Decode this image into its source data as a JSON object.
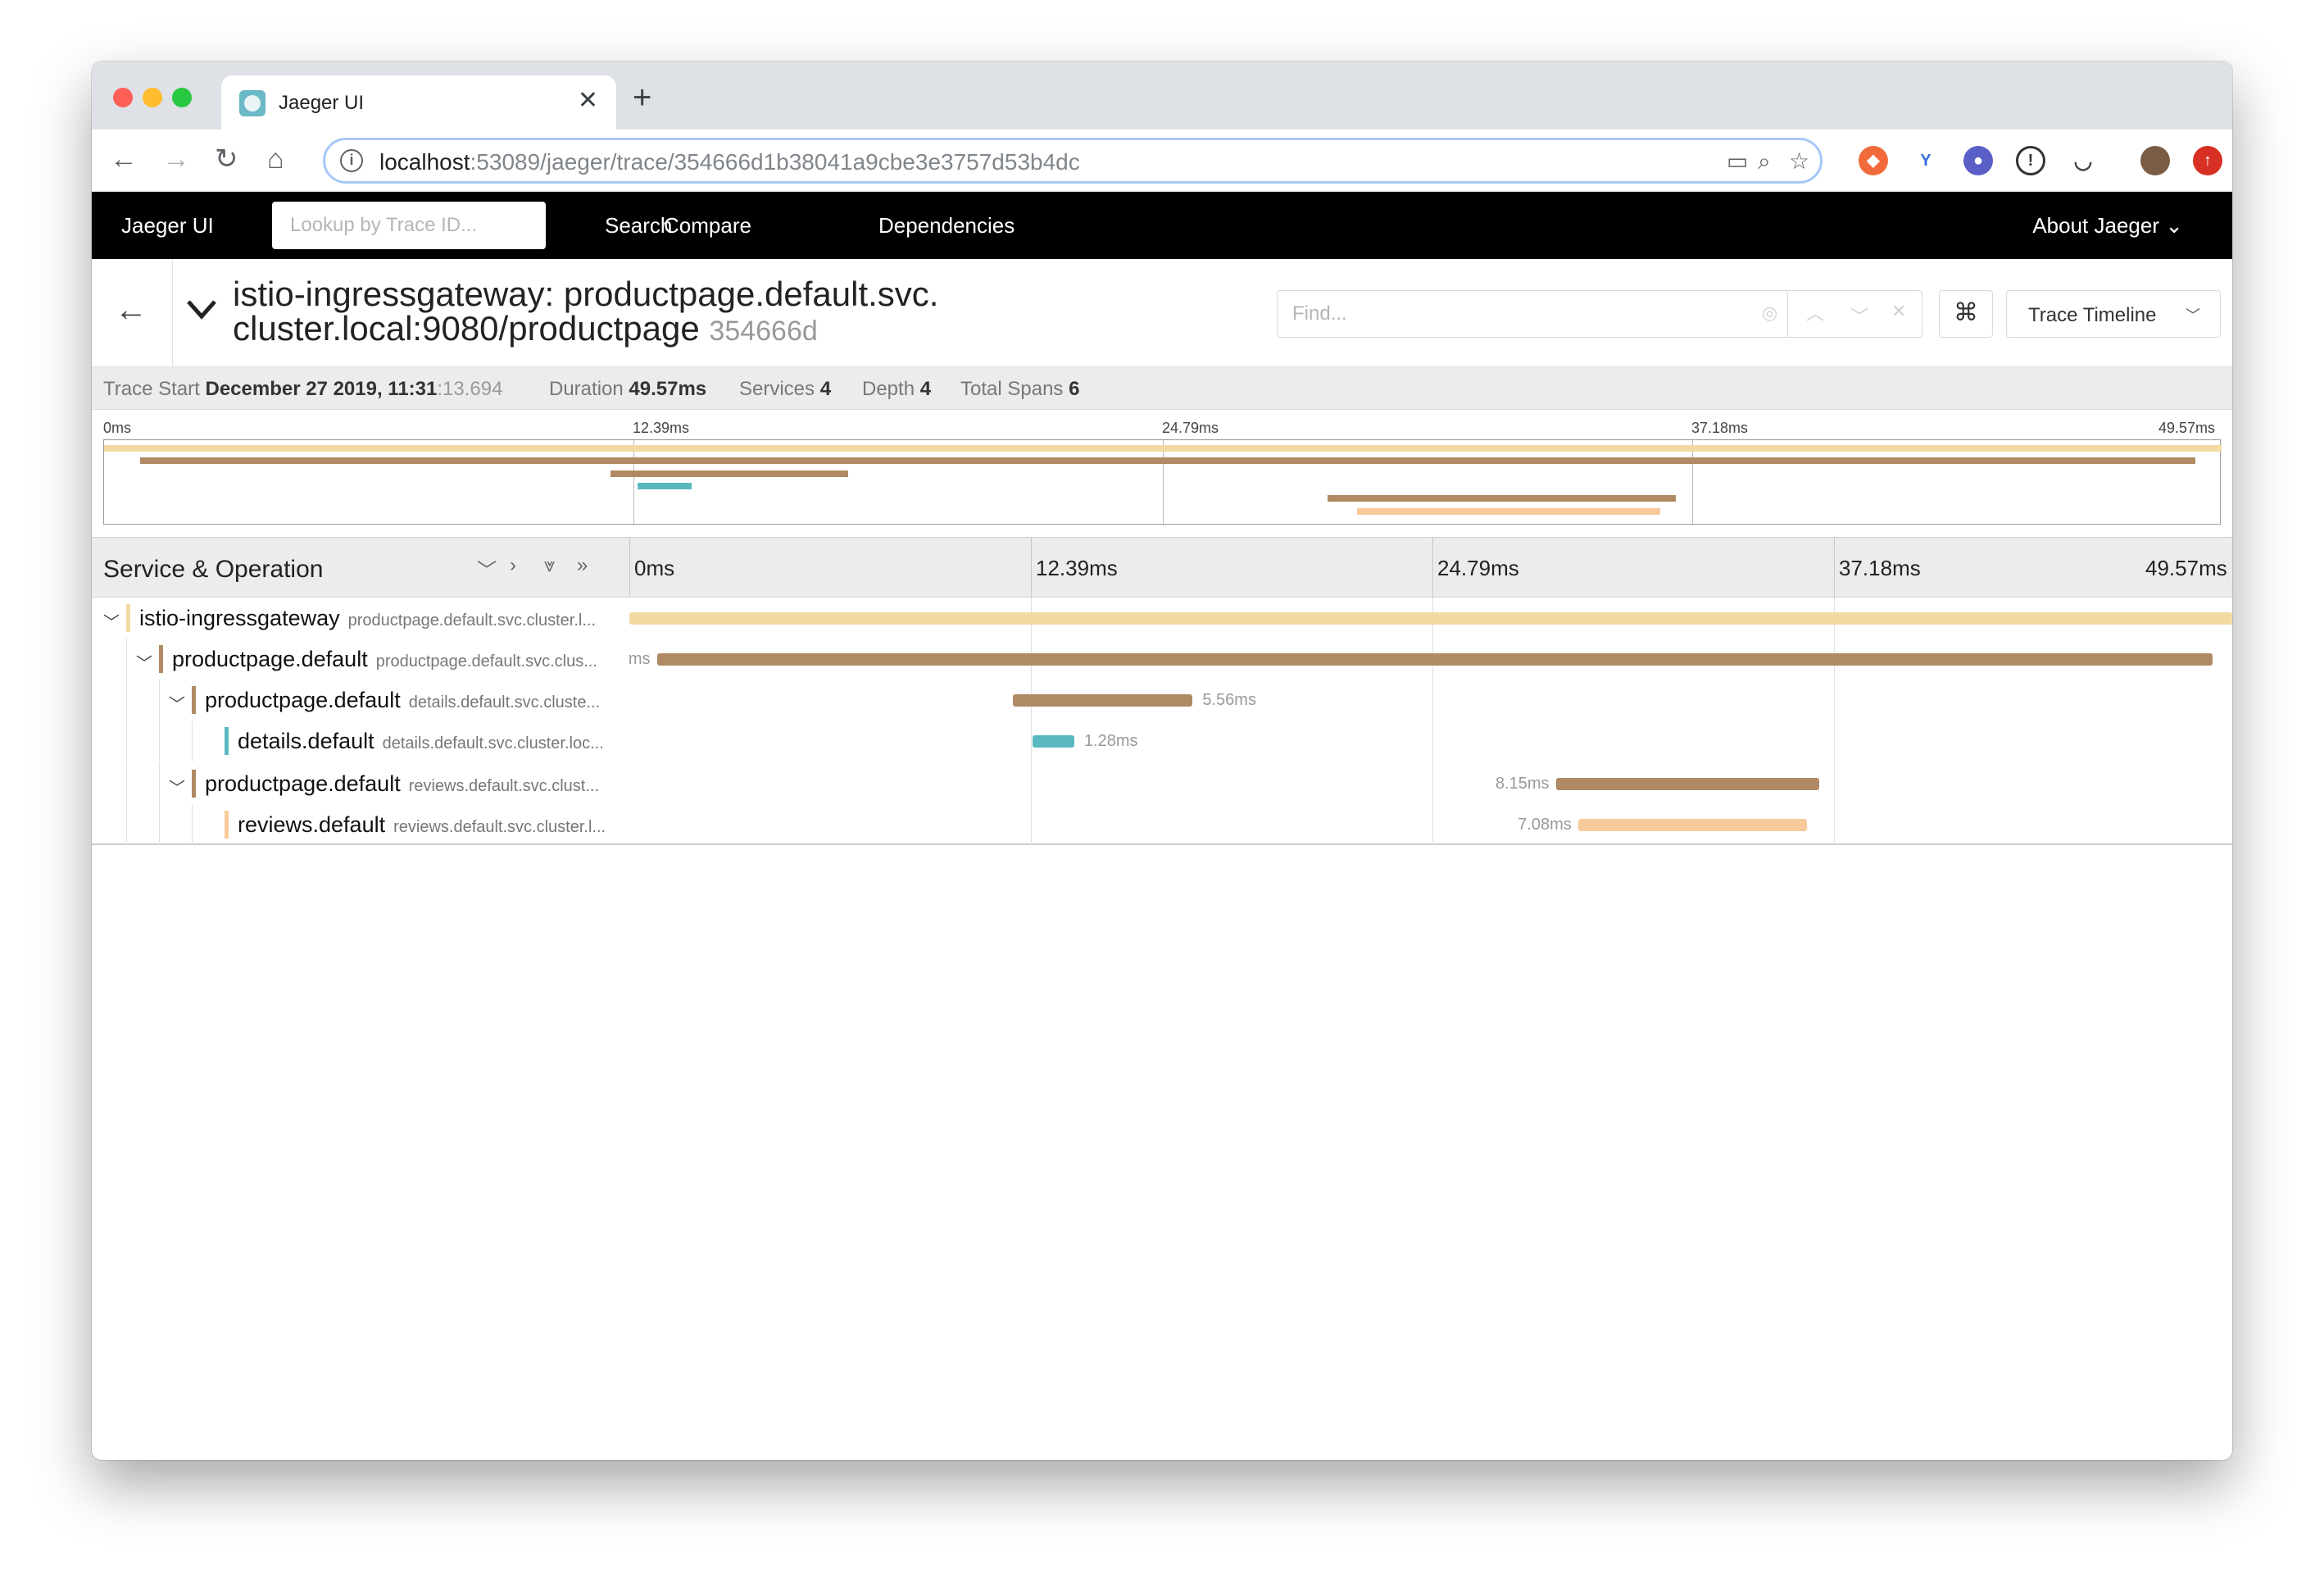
{
  "browser": {
    "tab_title": "Jaeger UI",
    "tab_close": "✕",
    "new_tab": "+",
    "url_host": "localhost",
    "url_rest": ":53089/jaeger/trace/354666d1b38041a9cbe3e3757d53b4dc"
  },
  "nav": {
    "brand": "Jaeger UI",
    "lookup_placeholder": "Lookup by Trace ID...",
    "search": "Search",
    "compare": "Compare",
    "dependencies": "Dependencies",
    "about": "About Jaeger ⌄"
  },
  "trace": {
    "title_line1": "istio-ingressgateway: productpage.default.svc.",
    "title_line2": "cluster.local:9080/productpage",
    "trace_id_short": "354666d",
    "find_placeholder": "Find...",
    "view_mode": "Trace Timeline",
    "keyboard_icon": "⌘"
  },
  "summary": {
    "trace_start_label": "Trace Start",
    "trace_start_value": "December 27 2019, 11:31",
    "trace_start_ms": ":13.694",
    "duration_label": "Duration",
    "duration_value": "49.57ms",
    "services_label": "Services",
    "services_value": "4",
    "depth_label": "Depth",
    "depth_value": "4",
    "total_spans_label": "Total Spans",
    "total_spans_value": "6"
  },
  "minimap": {
    "ticks": [
      "0ms",
      "12.39ms",
      "24.79ms",
      "37.18ms",
      "49.57ms"
    ]
  },
  "timeline": {
    "column_title": "Service & Operation",
    "ticks": [
      "0ms",
      "12.39ms",
      "24.79ms",
      "37.18ms",
      "49.57ms"
    ],
    "total_ms": 49.57
  },
  "colors": {
    "ingress": "#f3d9a2",
    "productpage": "#b08a65",
    "details": "#5ab8c0",
    "reviews": "#f8c99b"
  },
  "spans": [
    {
      "service": "istio-ingressgateway",
      "operation": "productpage.default.svc.cluster.l...",
      "depth": 0,
      "color": "ingress",
      "start_ms": 0.0,
      "duration_ms": 49.57,
      "label": "",
      "label_side": "none"
    },
    {
      "service": "productpage.default",
      "operation": "productpage.default.svc.clus...",
      "depth": 1,
      "color": "productpage",
      "start_ms": 0.85,
      "duration_ms": 48.1,
      "label": "ms",
      "label_side": "left"
    },
    {
      "service": "productpage.default",
      "operation": "details.default.svc.cluste...",
      "depth": 2,
      "color": "productpage",
      "start_ms": 11.86,
      "duration_ms": 5.56,
      "label": "5.56ms",
      "label_side": "right"
    },
    {
      "service": "details.default",
      "operation": "details.default.svc.cluster.loc...",
      "depth": 3,
      "color": "details",
      "start_ms": 12.48,
      "duration_ms": 1.28,
      "label": "1.28ms",
      "label_side": "right"
    },
    {
      "service": "productpage.default",
      "operation": "reviews.default.svc.clust...",
      "depth": 2,
      "color": "productpage",
      "start_ms": 28.65,
      "duration_ms": 8.15,
      "label": "8.15ms",
      "label_side": "left"
    },
    {
      "service": "reviews.default",
      "operation": "reviews.default.svc.cluster.l...",
      "depth": 3,
      "color": "reviews",
      "start_ms": 29.34,
      "duration_ms": 7.08,
      "label": "7.08ms",
      "label_side": "left"
    }
  ]
}
